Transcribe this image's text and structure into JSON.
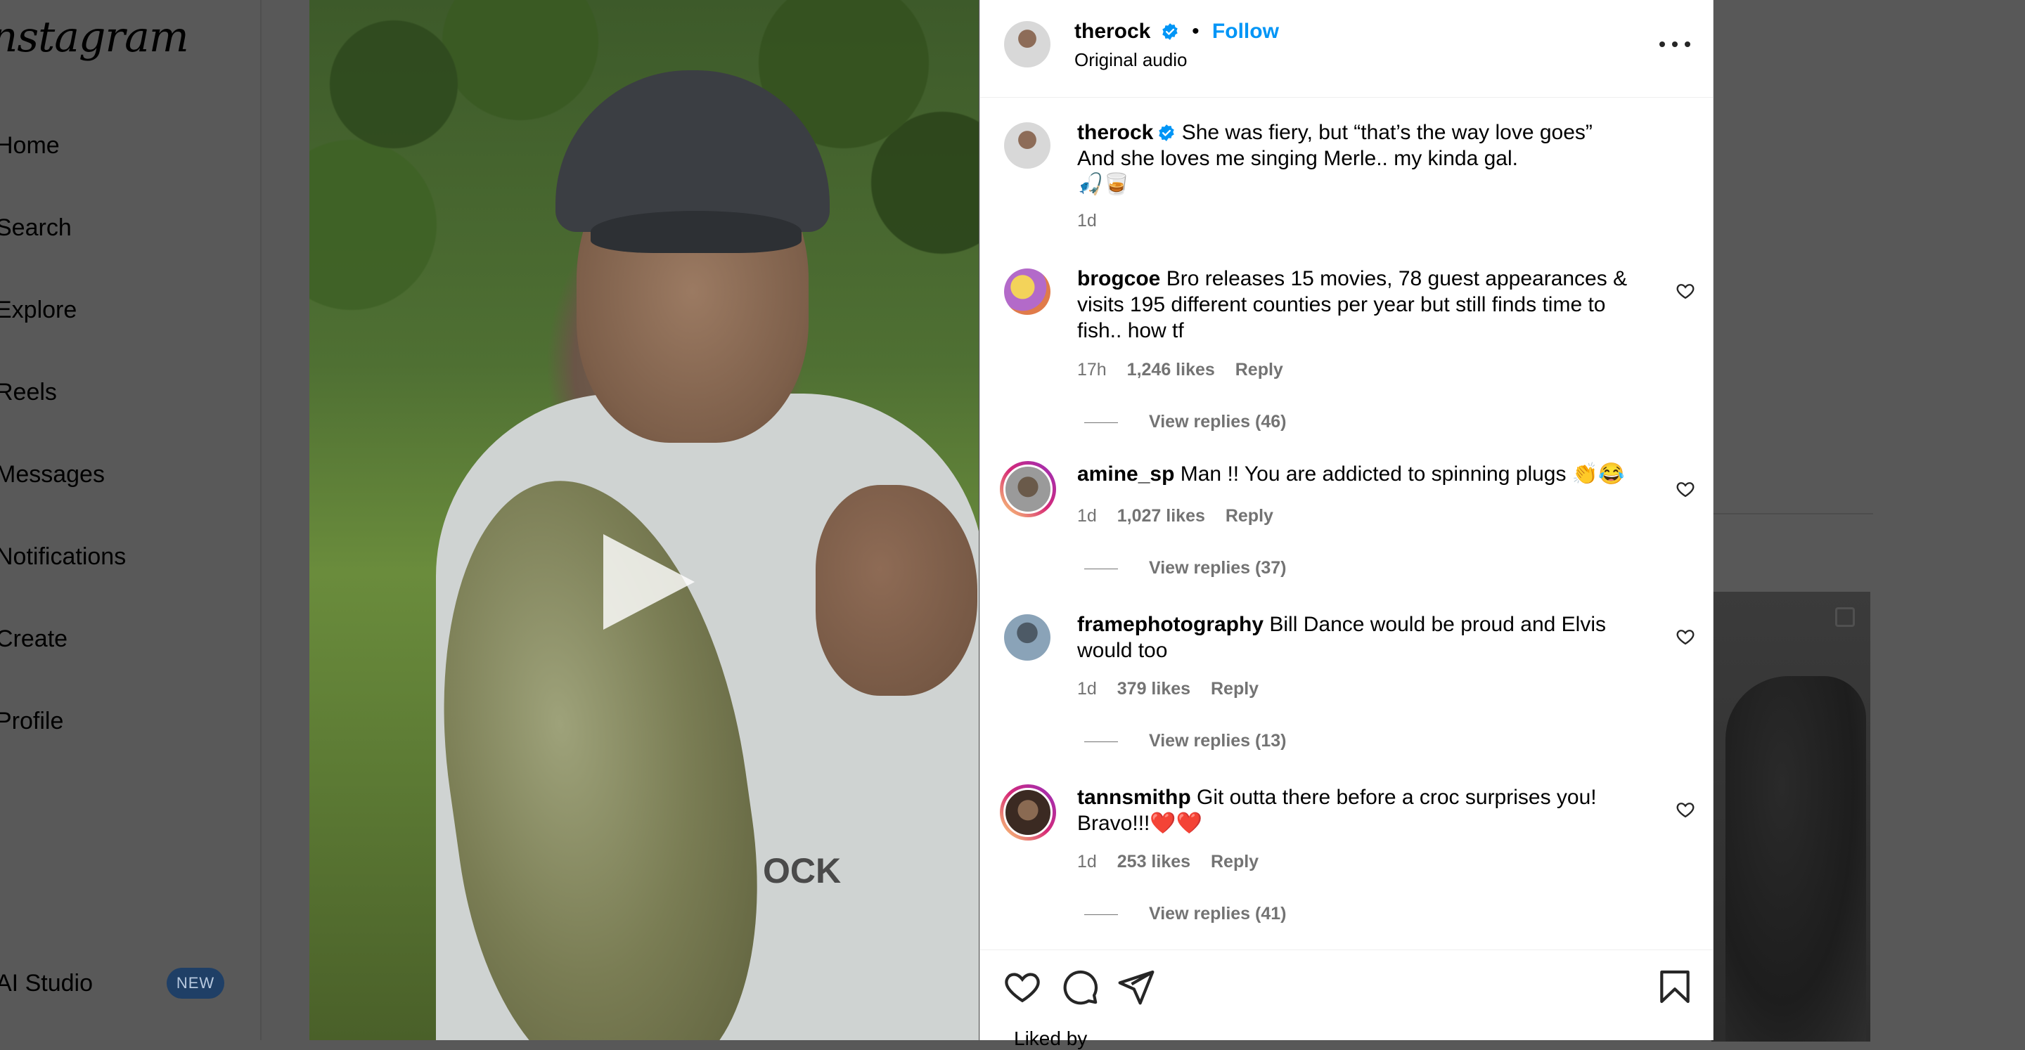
{
  "sidebar": {
    "logo": "Instagram",
    "items": [
      {
        "label": "Home"
      },
      {
        "label": "Search"
      },
      {
        "label": "Explore"
      },
      {
        "label": "Reels"
      },
      {
        "label": "Messages"
      },
      {
        "label": "Notifications"
      },
      {
        "label": "Create"
      },
      {
        "label": "Profile"
      },
      {
        "label": "AI Studio",
        "badge": "NEW"
      }
    ]
  },
  "video": {
    "shirt_text": "OCK",
    "play_icon": "play-icon"
  },
  "post": {
    "username": "therock",
    "separator": "•",
    "follow_label": "Follow",
    "audio": "Original audio",
    "caption": {
      "username": "therock",
      "line1": "She was fiery, but “that’s the way love goes”",
      "line2": "And she loves me singing Merle.. my kinda gal.",
      "line3": "🎣🥃",
      "time": "1d"
    },
    "comments": [
      {
        "username": "brogcoe",
        "text": "Bro releases 15 movies, 78 guest appearances & visits 195 different counties per year but still finds time to fish.. how tf",
        "time": "17h",
        "likes": "1,246 likes",
        "reply": "Reply",
        "view_replies": "View replies (46)"
      },
      {
        "username": "amine_sp",
        "text": "Man !! You are addicted to spinning plugs 👏😂",
        "time": "1d",
        "likes": "1,027 likes",
        "reply": "Reply",
        "view_replies": "View replies (37)"
      },
      {
        "username": "framephotography",
        "text": "Bill Dance would be proud and Elvis would too",
        "time": "1d",
        "likes": "379 likes",
        "reply": "Reply",
        "view_replies": "View replies (13)"
      },
      {
        "username": "tannsmithp",
        "text": "Git outta there before a croc surprises you! Bravo!!!❤️❤️",
        "time": "1d",
        "likes": "253 likes",
        "reply": "Reply",
        "view_replies": "View replies (41)"
      }
    ],
    "liked_by": "Liked by "
  },
  "colors": {
    "accent": "#0095f6",
    "verified": "#0095f6",
    "meta_text": "#737373",
    "ring_gradient": [
      "#feda75",
      "#d62976",
      "#962fbf"
    ]
  }
}
